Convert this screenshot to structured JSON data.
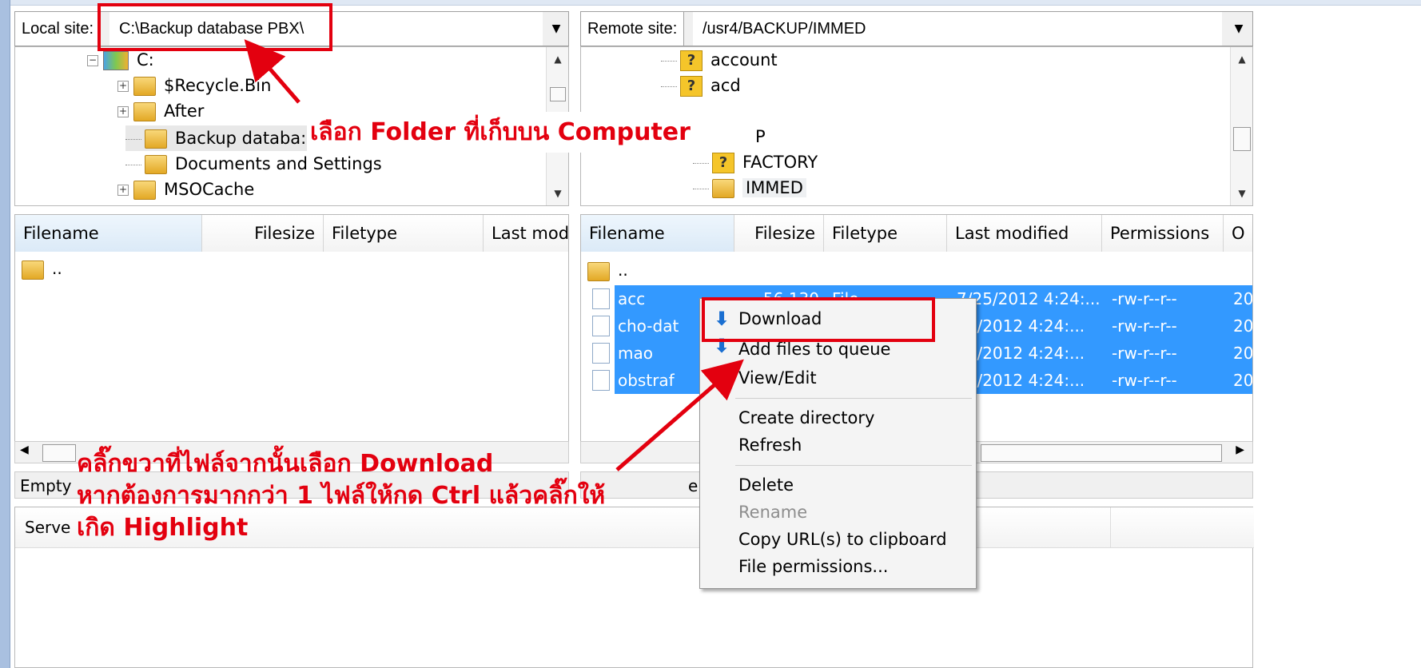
{
  "local": {
    "label": "Local site:",
    "path": "C:\\Backup database PBX\\",
    "tree": [
      {
        "name": "C:",
        "icon": "drive-icon",
        "expander": "−"
      },
      {
        "name": "$Recycle.Bin",
        "icon": "folder-icon",
        "expander": "+"
      },
      {
        "name": "After",
        "icon": "folder-icon",
        "expander": "+"
      },
      {
        "name": "Backup databa:",
        "icon": "folder-icon",
        "expander": ""
      },
      {
        "name": "Documents and Settings",
        "icon": "folder-icon",
        "expander": ""
      },
      {
        "name": "MSOCache",
        "icon": "folder-icon",
        "expander": "+"
      }
    ],
    "columns": [
      "Filename",
      "Filesize",
      "Filetype",
      "Last mod"
    ],
    "rows": [
      {
        "name": ".."
      }
    ],
    "status": "Empty"
  },
  "remote": {
    "label": "Remote site:",
    "path": "/usr4/BACKUP/IMMED",
    "tree": [
      {
        "name": "account",
        "icon": "question-folder-icon"
      },
      {
        "name": "acd",
        "icon": "question-folder-icon"
      },
      {
        "name": "P",
        "icon": ""
      },
      {
        "name": "FACTORY",
        "icon": "question-folder-icon"
      },
      {
        "name": "IMMED",
        "icon": "folder-icon"
      }
    ],
    "columns": [
      "Filename",
      "Filesize",
      "Filetype",
      "Last modified",
      "Permissions",
      "O"
    ],
    "parent_row": "..",
    "rows": [
      {
        "name": "acc",
        "size": "56 130",
        "type": "File",
        "modified": "7/25/2012 4:24:...",
        "perms": "-rw-r--r--",
        "owner": "20"
      },
      {
        "name": "cho-dat",
        "size": "",
        "type": "",
        "modified": "25/2012 4:24:...",
        "perms": "-rw-r--r--",
        "owner": "20"
      },
      {
        "name": "mao",
        "size": "",
        "type": "",
        "modified": "25/2012 4:24:...",
        "perms": "-rw-r--r--",
        "owner": "20"
      },
      {
        "name": "obstraf",
        "size": "",
        "type": "",
        "modified": "25/2012 4:24:...",
        "perms": "-rw-r--r--",
        "owner": "20"
      }
    ]
  },
  "queue": {
    "server_col": "Serve",
    "status_frag": "e"
  },
  "context_menu": {
    "items": [
      {
        "label": "Download",
        "disabled": false
      },
      {
        "label": "Add files to queue",
        "disabled": false
      },
      {
        "label": "View/Edit",
        "disabled": false
      },
      {
        "label": "Create directory",
        "disabled": false
      },
      {
        "label": "Refresh",
        "disabled": false
      },
      {
        "label": "Delete",
        "disabled": false
      },
      {
        "label": "Rename",
        "disabled": true
      },
      {
        "label": "Copy URL(s) to clipboard",
        "disabled": false
      },
      {
        "label": "File permissions...",
        "disabled": false
      }
    ]
  },
  "annotations": {
    "folder_hint": "เลือก Folder ที่เก็บบน Computer",
    "download_hint_1": "คลิ๊กขวาที่ไฟล์จากนั้นเลือก Download",
    "download_hint_2": "หากต้องการมากกว่า 1 ไฟล์ให้กด Ctrl แล้วคลิ๊กให้",
    "download_hint_3": "เกิด Highlight",
    "color": "#e3000f"
  },
  "colors": {
    "selection": "#3399ff",
    "annotation": "#e3000f"
  }
}
